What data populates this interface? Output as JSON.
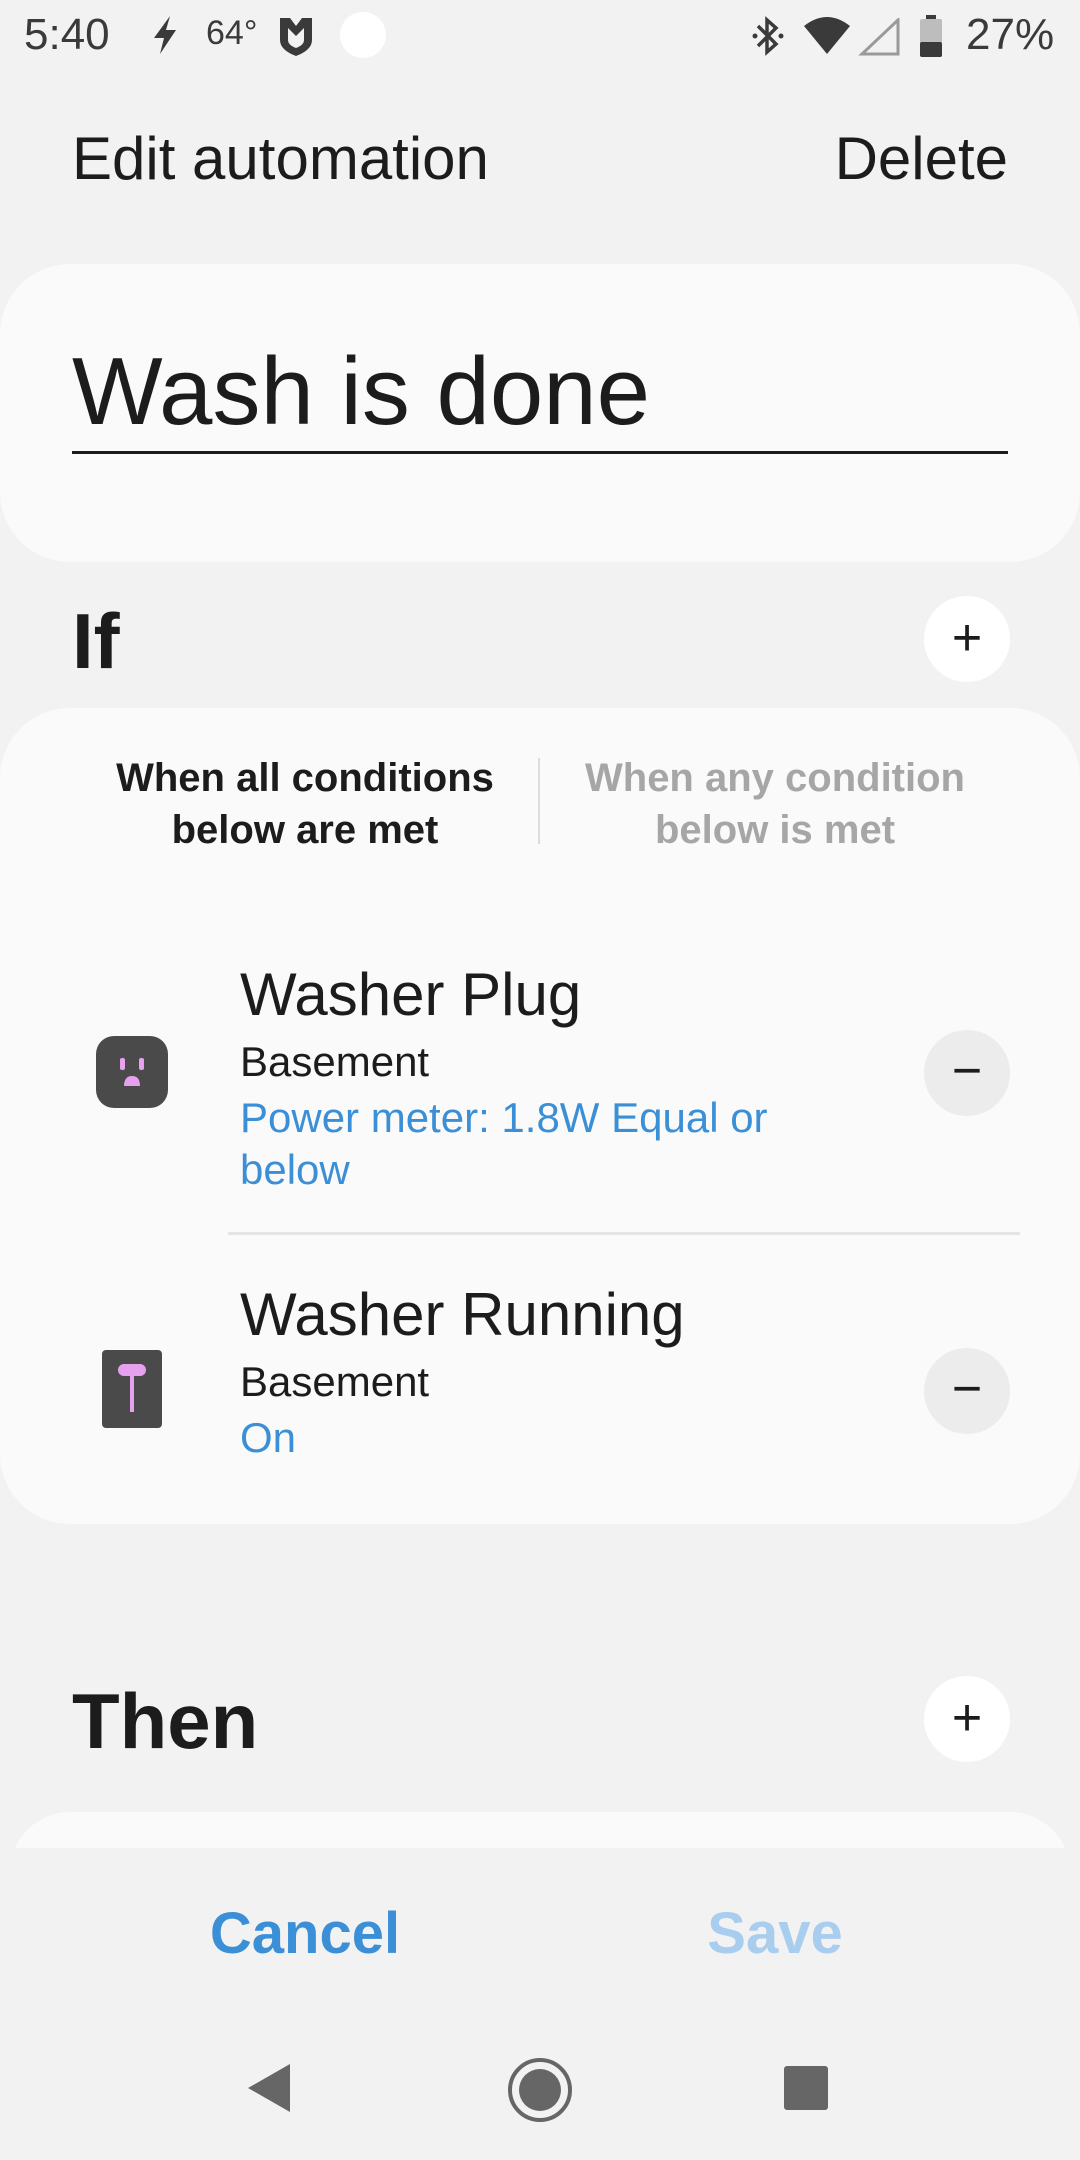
{
  "status_bar": {
    "time": "5:40",
    "temperature": "64°",
    "battery_percent": "27%",
    "icons": [
      "flash-icon",
      "shield-icon",
      "notification-dot-icon",
      "bluetooth-icon",
      "wifi-icon",
      "cell-signal-icon",
      "battery-icon"
    ]
  },
  "header": {
    "title": "Edit automation",
    "delete_label": "Delete"
  },
  "automation_name": {
    "value": "Wash is done"
  },
  "if_section": {
    "label": "If",
    "add_icon": "plus-icon",
    "mode_all_label": "When all conditions below are met",
    "mode_any_label": "When any condition below is met",
    "selected_mode": "all",
    "conditions": [
      {
        "title": "Washer Plug",
        "location": "Basement",
        "value": "Power meter: 1.8W Equal or below",
        "icon": "smart-plug-icon",
        "remove_icon": "minus-icon"
      },
      {
        "title": "Washer Running",
        "location": "Basement",
        "value": "On",
        "icon": "switch-icon",
        "remove_icon": "minus-icon"
      }
    ]
  },
  "then_section": {
    "label": "Then",
    "add_icon": "plus-icon"
  },
  "actions": {
    "cancel_label": "Cancel",
    "save_label": "Save"
  },
  "nav_bar": {
    "icons": [
      "back-icon",
      "home-icon",
      "recents-icon"
    ]
  },
  "colors": {
    "accent": "#3b8fd6",
    "accent_disabled": "#a9cdef",
    "background": "#f2f2f2",
    "card": "#fafafa",
    "muted_text": "#a6a6a6",
    "device_tile": "#4a4a4a",
    "device_highlight": "#e6a0ee"
  }
}
